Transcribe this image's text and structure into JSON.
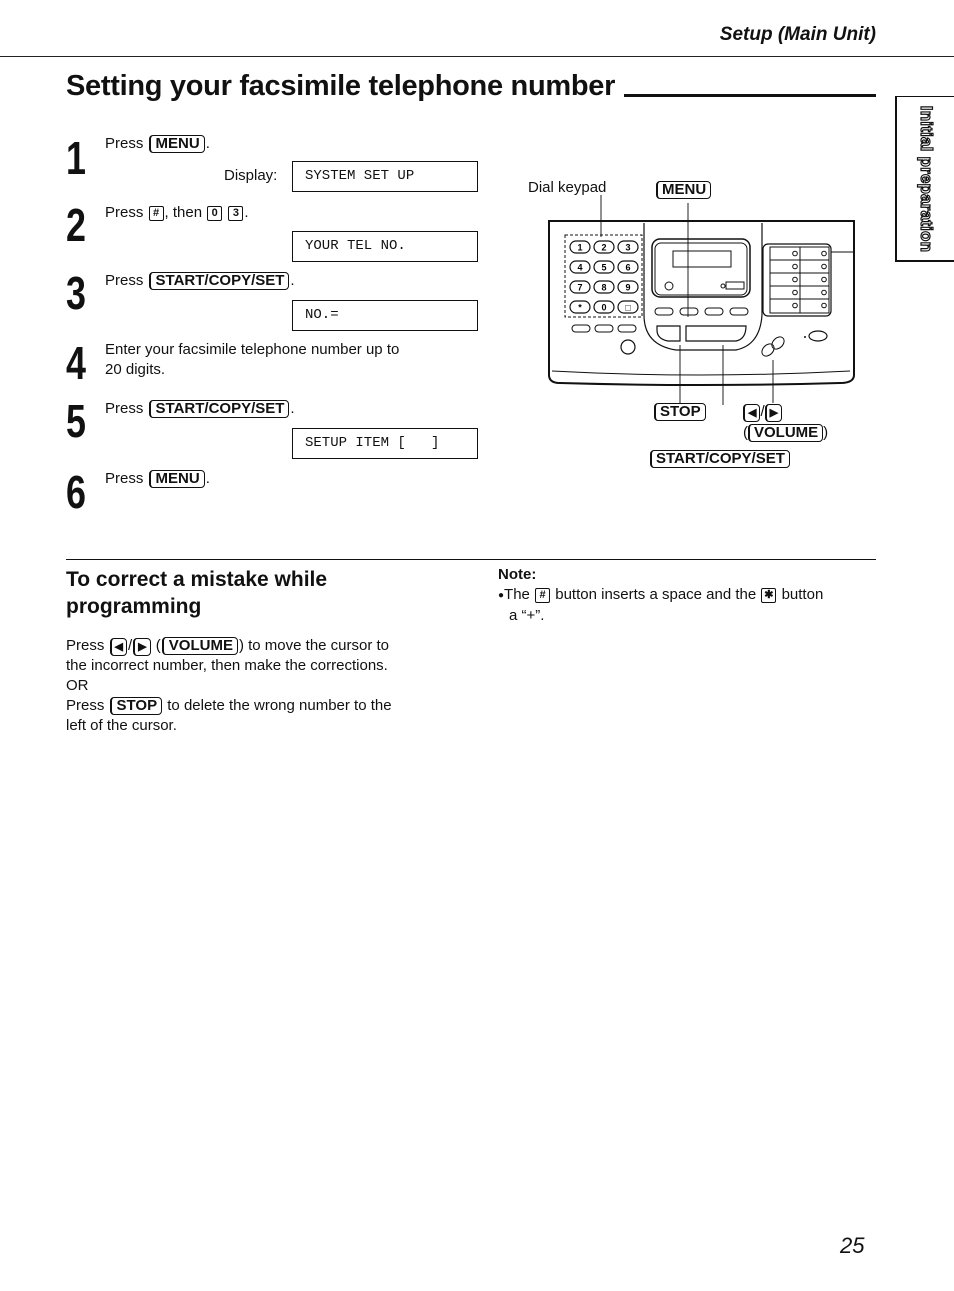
{
  "header": {
    "section_title": "Setup (Main Unit)"
  },
  "page": {
    "title": "Setting your facsimile telephone number",
    "side_tab": "Initial preparation",
    "page_number": "25"
  },
  "steps": [
    {
      "number": "1",
      "prefix": "Press",
      "key": "MENU",
      "suffix": ".",
      "display_label": "Display:",
      "display": "SYSTEM SET UP"
    },
    {
      "number": "2",
      "prefix": "Press",
      "key1": "#",
      "middle": ", then",
      "key2": "0",
      "key3": "3",
      "suffix": ".",
      "display": "YOUR TEL NO."
    },
    {
      "number": "3",
      "prefix": "Press",
      "key": "START/COPY/SET",
      "suffix": ".",
      "display": "NO.="
    },
    {
      "number": "4",
      "line1": "Enter your facsimile telephone number up to",
      "line2": "20 digits."
    },
    {
      "number": "5",
      "prefix": "Press",
      "key": "START/COPY/SET",
      "suffix": ".",
      "display": "SETUP ITEM [   ]"
    },
    {
      "number": "6",
      "prefix": "Press",
      "key": "MENU",
      "suffix": "."
    }
  ],
  "diagram": {
    "labels": {
      "dial_keypad": "Dial keypad",
      "menu": "MENU",
      "stop": "STOP",
      "left_arrow": "◀",
      "right_arrow": "▶",
      "slash": "/",
      "volume": "VOLUME",
      "start_copy_set": "START/COPY/SET"
    },
    "keypad": [
      "1",
      "2",
      "3",
      "4",
      "5",
      "6",
      "7",
      "8",
      "9",
      "*",
      "0",
      "□"
    ]
  },
  "correct_section": {
    "title": "To correct a mistake while programming",
    "para1_prefix": "Press",
    "para1_left": "◀",
    "para1_right": "▶",
    "para1_volume": "VOLUME",
    "para1_suffix": ") to move the cursor to",
    "para1_line2": "the incorrect number, then make the corrections.",
    "or": "OR",
    "para2_prefix": "Press",
    "para2_key": "STOP",
    "para2_suffix": "to delete the wrong number to the",
    "para2_line2": "left of the cursor."
  },
  "note": {
    "title": "Note:",
    "bullet": "●",
    "text1": "The",
    "key1": "#",
    "text2": "button inserts a space and the",
    "key2": "✱",
    "text3": "button",
    "line2": "a “+”."
  }
}
